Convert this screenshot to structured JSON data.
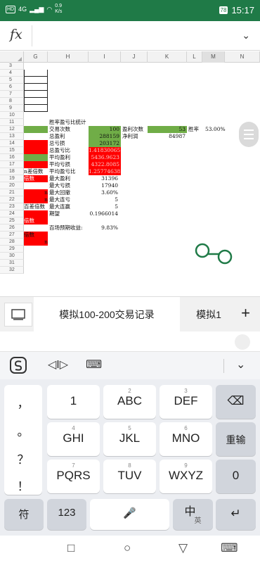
{
  "status": {
    "network": "4G",
    "hd": "HD",
    "speed_value": "0.9",
    "speed_unit": "K/s",
    "battery": "78",
    "time": "15:17"
  },
  "formula_bar": {
    "fx": "fx",
    "chevron": "⌄"
  },
  "columns": [
    "G",
    "H",
    "I",
    "J",
    "K",
    "L",
    "M",
    "N"
  ],
  "rows": [
    "3",
    "4",
    "5",
    "6",
    "7",
    "8",
    "9",
    "10",
    "11",
    "12",
    "13",
    "14",
    "15",
    "16",
    "17",
    "18",
    "19",
    "20",
    "21",
    "22",
    "23",
    "24",
    "25",
    "26",
    "27",
    "28",
    "29",
    "30",
    "31",
    "32"
  ],
  "cells": {
    "title": "胜率盈亏比统计",
    "trade_count_label": "交易次数",
    "trade_count": "100",
    "win_count_label": "盈利次数",
    "win_count": "53",
    "win_rate_label": "胜率",
    "win_rate": "53.00%",
    "total_profit_label": "总盈利",
    "total_profit": "288159",
    "net_profit_label": "净利润",
    "net_profit": "84987",
    "total_loss_label": "总亏损",
    "total_loss": "203172",
    "total_ratio_label": "总盈亏比",
    "total_ratio": "1.41830065",
    "avg_profit_label": "平均盈利",
    "avg_profit": "5436.9623",
    "avg_loss_label": "平均亏损",
    "avg_loss": "4322.8085",
    "avg_ratio_label": "平均盈亏比",
    "avg_ratio": "1.25774638",
    "max_profit_label": "最大盈利",
    "max_profit": "31396",
    "max_loss_label": "最大亏损",
    "max_loss": "17940",
    "max_drawdown_label": "最大回撤",
    "max_drawdown": "3.60%",
    "max_cons_loss_label": "最大连亏",
    "max_cons_loss": "5",
    "max_cons_win_label": "最大连赢",
    "max_cons_win": "5",
    "expectation_label": "期望",
    "expectation": "0.1966014",
    "hundred_return_label": "百场预期收益:",
    "hundred_return": "9.83%",
    "frag_17": "n差倍数",
    "frag_18": "倍数",
    "frag_20": "n",
    "frag_21": "n",
    "frag_22": "百差倍数",
    "frag_23": "倍数",
    "frag_26": "倍数",
    "frag_27": "n"
  },
  "tabs": {
    "active": "模拟100-200交易记录",
    "other": "模拟1",
    "add": "+"
  },
  "keyboard": {
    "punct": [
      "，",
      "。",
      "？",
      "！"
    ],
    "keys": [
      {
        "num": "",
        "lbl": "1"
      },
      {
        "num": "2",
        "lbl": "ABC"
      },
      {
        "num": "3",
        "lbl": "DEF"
      },
      {
        "num": "4",
        "lbl": "GHI"
      },
      {
        "num": "5",
        "lbl": "JKL"
      },
      {
        "num": "6",
        "lbl": "MNO"
      },
      {
        "num": "7",
        "lbl": "PQRS"
      },
      {
        "num": "8",
        "lbl": "TUV"
      },
      {
        "num": "9",
        "lbl": "WXYZ"
      }
    ],
    "reinput": "重输",
    "zero": "0",
    "symbol": "符",
    "num123": "123",
    "lang_main": "中",
    "lang_sub": "英"
  },
  "colors": {
    "accent": "#1f7a47",
    "red": "#ff0000",
    "green": "#70ad47"
  }
}
